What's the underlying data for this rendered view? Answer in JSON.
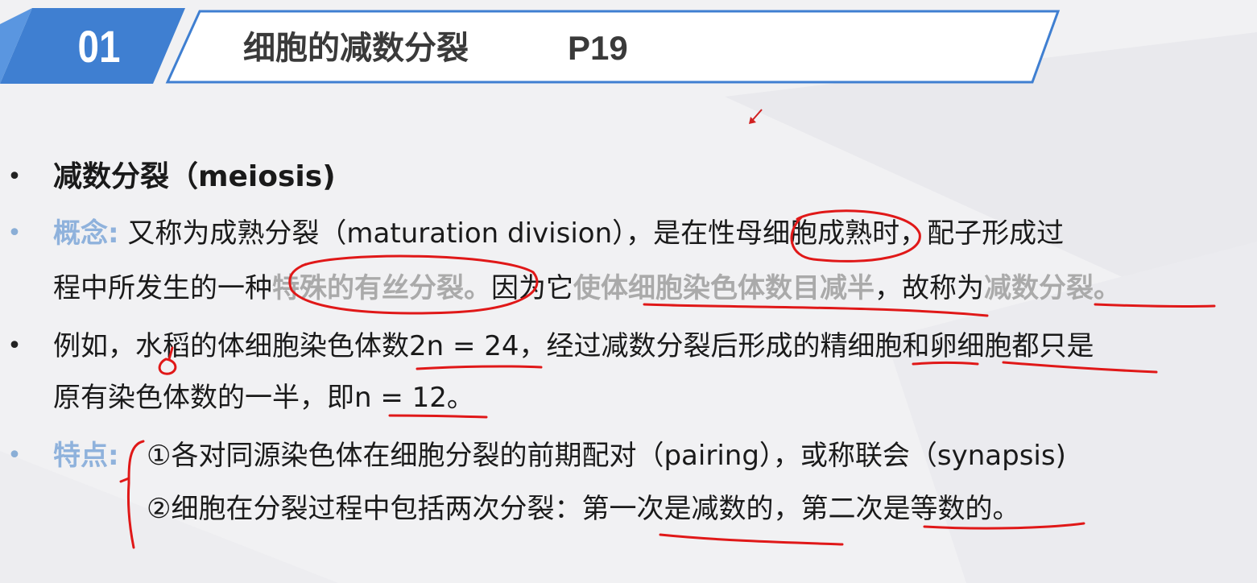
{
  "header": {
    "number": "01",
    "title": "细胞的减数分裂",
    "page": "P19"
  },
  "colors": {
    "badge_blue": "#3f7fd1",
    "badge_light": "#5a96e0",
    "frame_blue": "#3f7fd1",
    "label_blue": "#8fb2dc",
    "annotation_red": "#e01818",
    "underline_red": "#d81a1a"
  },
  "icons": {
    "cursor": "pointer-arrow-icon",
    "bullet": "bullet-dot-icon"
  },
  "content": {
    "heading": {
      "bullet": "•",
      "text": "减数分裂（meiosis)"
    },
    "concept": {
      "bullet": "•",
      "label": "概念:",
      "line1": "又称为成熟分裂（maturation division），是在性母细胞成熟时，配子形成过",
      "line2_prefix": "程中所发生的一种",
      "line2_faded1": "特殊的有丝分裂。",
      "line2_mid": "因为它",
      "line2_faded2": "使体细胞染色体数目减半",
      "line2_suffix": "，故称为",
      "line2_faded3": "减数分裂。"
    },
    "example": {
      "bullet": "•",
      "line1": "例如，水稻的体细胞染色体数2n = 24，经过减数分裂后形成的精细胞和卵细胞都只是",
      "line2": "原有染色体数的一半，即n = 12。"
    },
    "features": {
      "bullet": "•",
      "label": "特点:",
      "item1": "①各对同源染色体在细胞分裂的前期配对（pairing），或称联会（synapsis)",
      "item2": "②细胞在分裂过程中包括两次分裂：第一次是减数的，第二次是等数的。"
    }
  }
}
